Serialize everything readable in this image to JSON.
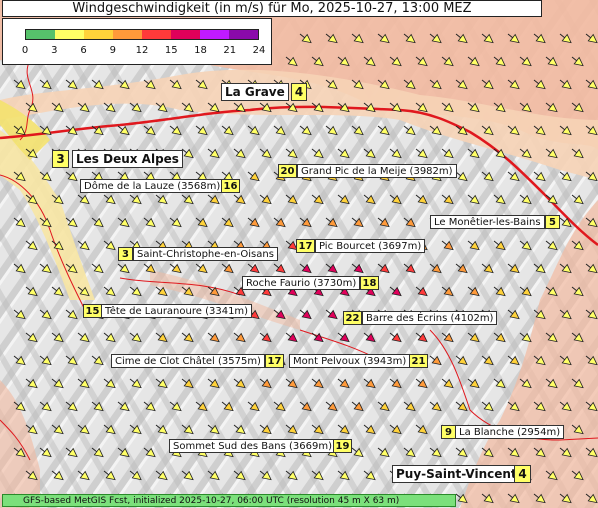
{
  "title": "Windgeschwindigkeit (in m/s) für Mo, 2025-10-27, 13:00 MEZ",
  "legend": {
    "ticks": [
      "0",
      "3",
      "6",
      "9",
      "12",
      "15",
      "18",
      "21",
      "24"
    ],
    "colors": [
      "#56c26b",
      "#ffff66",
      "#ffd23a",
      "#ff9a3a",
      "#ff3a3a",
      "#e0005a",
      "#c01aff",
      "#8a0aaa"
    ]
  },
  "places": [
    {
      "name": "La Grave",
      "value": "4",
      "big": true
    },
    {
      "name": "Les Deux Alpes",
      "value": "3",
      "big": true
    },
    {
      "name": "Grand Pic de la Meije (3982m)",
      "value": "20"
    },
    {
      "name": "Dôme de la Lauze (3568m)",
      "value": "16"
    },
    {
      "name": "Le Monêtier-les-Bains",
      "value": "5"
    },
    {
      "name": "Pic Bourcet (3697m)",
      "value": "17"
    },
    {
      "name": "Saint-Christophe-en-Oisans",
      "value": "3"
    },
    {
      "name": "Roche Faurio (3730m)",
      "value": "18"
    },
    {
      "name": "Tête de Lauranoure (3341m)",
      "value": "15"
    },
    {
      "name": "Barre des Écrins (4102m)",
      "value": "22"
    },
    {
      "name": "Cime de Clot Châtel (3575m)",
      "value": "17"
    },
    {
      "name": "Mont Pelvoux (3943m)",
      "value": "21"
    },
    {
      "name": "La Blanche (2954m)",
      "value": "9"
    },
    {
      "name": "Sommet Sud des Bans (3669m)",
      "value": "19"
    },
    {
      "name": "Puy-Saint-Vincent",
      "value": "4",
      "big": true
    }
  ],
  "footer": "GFS-based MetGIS Fcst, initialized 2025-10-27, 06:00 UTC  (resolution 45 m X 63 m)"
}
